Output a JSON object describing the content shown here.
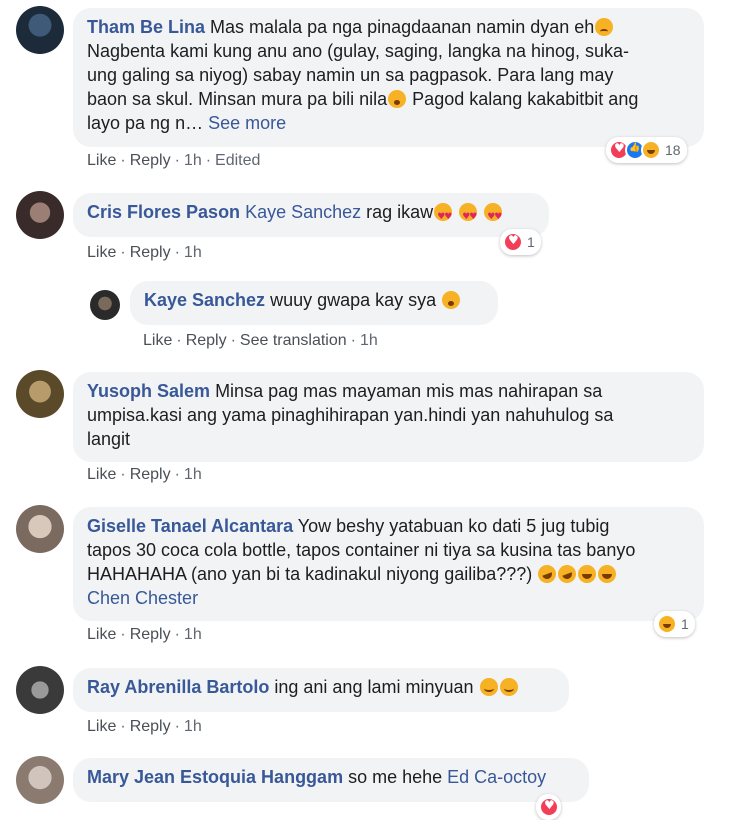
{
  "comments": [
    {
      "author": "Tham Be Lina",
      "lines": [
        "Mas malala pa nga pinagdaanan namin dyan eh",
        "Nagbenta kami kung anu ano (gulay, saging, langka na hinog, suka-",
        "ung galing sa niyog) sabay namin un sa pagpasok. Para lang may",
        "baon sa skul. Minsan mura pa bili nila",
        "Pagod kalang kakabitbit ang",
        "layo pa ng n… "
      ],
      "see_more": "See more",
      "like": "Like",
      "reply": "Reply",
      "time": "1h",
      "edited": "Edited",
      "reaction_count": "18",
      "avatar_colors": [
        "#1c2a3a",
        "#3e5a78"
      ]
    },
    {
      "author": "Cris Flores Pason",
      "mention": "Kaye Sanchez",
      "text": " rag ikaw",
      "like": "Like",
      "reply": "Reply",
      "time": "1h",
      "reaction_count": "1",
      "avatar_colors": [
        "#3a2b2b",
        "#9b7f74"
      ]
    },
    {
      "author": "Kaye Sanchez",
      "text": " wuuy gwapa kay sya ",
      "like": "Like",
      "reply": "Reply",
      "translation": "See translation",
      "time": "1h",
      "avatar_colors": [
        "#2a2a2a",
        "#7a6a5a"
      ]
    },
    {
      "author": "Yusoph Salem",
      "lines": [
        "Minsa pag mas mayaman mis mas nahirapan sa",
        "umpisa.kasi ang yama pinaghihirapan yan.hindi yan nahuhulog sa",
        "langit"
      ],
      "like": "Like",
      "reply": "Reply",
      "time": "1h",
      "avatar_colors": [
        "#5a4a2a",
        "#b89b6a"
      ]
    },
    {
      "author": "Giselle Tanael Alcantara",
      "lines": [
        "Yow beshy yatabuan ko dati 5 jug tubig",
        "tapos 30 coca cola bottle, tapos container ni tiya sa kusina tas banyo",
        "HAHAHAHA (ano yan bi ta kadinakul niyong gailiba???) "
      ],
      "mention": "Chen Chester",
      "like": "Like",
      "reply": "Reply",
      "time": "1h",
      "reaction_count": "1",
      "avatar_colors": [
        "#7a6a60",
        "#d8c8bc"
      ]
    },
    {
      "author": "Ray Abrenilla Bartolo",
      "text": " ing ani ang lami minyuan ",
      "like": "Like",
      "reply": "Reply",
      "time": "1h",
      "avatar_colors": [
        "#3a3a3a",
        "#9a9a9a"
      ]
    },
    {
      "author": "Mary Jean Estoquia Hanggam",
      "text": " so me hehe ",
      "mention": "Ed Ca-octoy",
      "avatar_colors": [
        "#8a7a70",
        "#d0c4bc"
      ]
    }
  ]
}
